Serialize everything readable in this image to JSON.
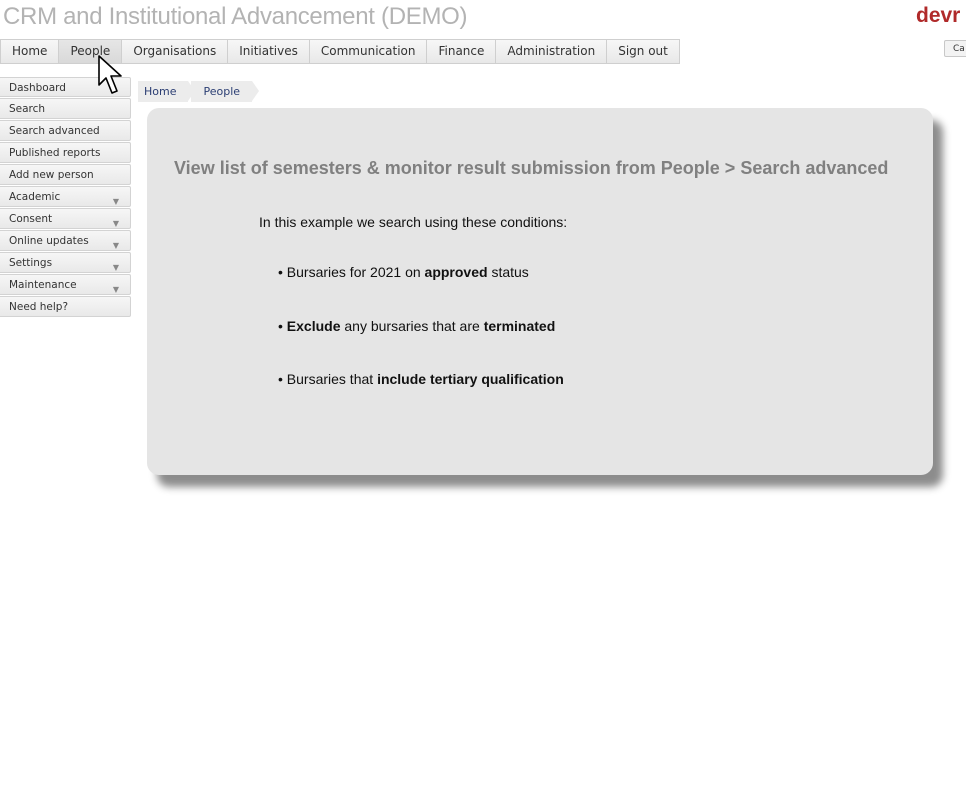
{
  "header": {
    "app_title": "CRM and Institutional Advancement (DEMO)",
    "brand_logo_text": "devr",
    "right_stub_text": "Ca"
  },
  "top_nav": {
    "items": [
      "Home",
      "People",
      "Organisations",
      "Initiatives",
      "Communication",
      "Finance",
      "Administration",
      "Sign out"
    ],
    "active": "People"
  },
  "sidebar": {
    "items": [
      {
        "label": "Dashboard",
        "has_submenu": false
      },
      {
        "label": "Search",
        "has_submenu": false
      },
      {
        "label": "Search advanced",
        "has_submenu": false
      },
      {
        "label": "Published reports",
        "has_submenu": false
      },
      {
        "label": "Add new person",
        "has_submenu": false
      },
      {
        "label": "Academic",
        "has_submenu": true
      },
      {
        "label": "Consent",
        "has_submenu": true
      },
      {
        "label": "Online updates",
        "has_submenu": true
      },
      {
        "label": "Settings",
        "has_submenu": true
      },
      {
        "label": "Maintenance",
        "has_submenu": true
      },
      {
        "label": "Need help?",
        "has_submenu": false
      }
    ]
  },
  "breadcrumb": [
    "Home",
    "People"
  ],
  "panel": {
    "title": "View list of semesters & monitor result submission from People > Search advanced",
    "intro": "In this example we search using these conditions:",
    "conditions": [
      {
        "prefix": "• Bursaries for 2021 on ",
        "bold1": "approved",
        "mid": " status",
        "bold2": "",
        "suffix": ""
      },
      {
        "prefix": "• ",
        "bold1": "Exclude",
        "mid": " any bursaries that are ",
        "bold2": "terminated",
        "suffix": ""
      },
      {
        "prefix": "• Bursaries that ",
        "bold1": "include tertiary qualification",
        "mid": "",
        "bold2": "",
        "suffix": ""
      }
    ]
  },
  "colors": {
    "brand": "#b02a2a",
    "title_gray": "#b3b3b3",
    "panel_bg": "#e5e5e5",
    "breadcrumb_link": "#2b3e73"
  },
  "icons": {
    "mouse_cursor": "arrow-cursor-icon",
    "submenu_caret": "caret-down-icon"
  }
}
